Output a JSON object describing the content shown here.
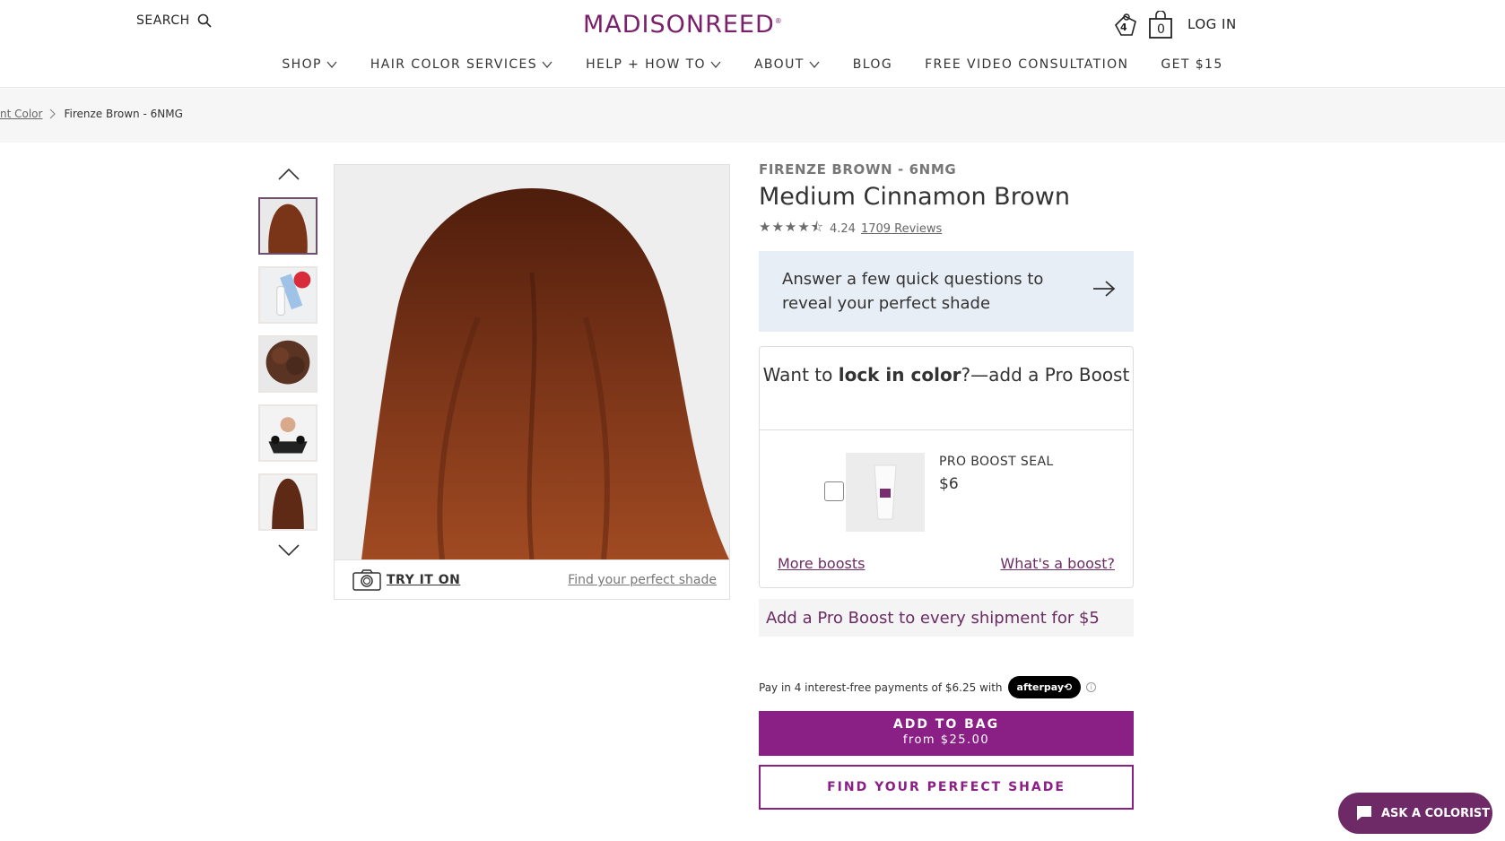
{
  "header": {
    "search_label": "SEARCH",
    "logo": "MADISONREED",
    "logo_reg": "®",
    "rewards_count": "4",
    "bag_count": "0",
    "login_label": "LOG IN"
  },
  "nav": {
    "items": [
      {
        "label": "SHOP",
        "dropdown": true
      },
      {
        "label": "HAIR COLOR SERVICES",
        "dropdown": true
      },
      {
        "label": "HELP + HOW TO",
        "dropdown": true
      },
      {
        "label": "ABOUT",
        "dropdown": true
      },
      {
        "label": "BLOG",
        "dropdown": false
      },
      {
        "label": "FREE VIDEO CONSULTATION",
        "dropdown": false
      },
      {
        "label": "GET $15",
        "dropdown": false
      }
    ]
  },
  "breadcrumb": {
    "parent": "nt Color",
    "current": "Firenze Brown - 6NMG"
  },
  "gallery": {
    "try_on": "TRY IT ON",
    "find_shade": "Find your perfect shade"
  },
  "product": {
    "shade_code": "FIRENZE BROWN - 6NMG",
    "name": "Medium Cinnamon Brown",
    "stars": "★★★★⯪",
    "rating": "4.24",
    "reviews": "1709 Reviews"
  },
  "quiz": {
    "text": "Answer a few quick questions to reveal your perfect shade"
  },
  "boost": {
    "head_pre": "Want to ",
    "head_bold": "lock in color",
    "head_post": "?—add a Pro Boost",
    "name": "PRO BOOST SEAL",
    "price": "$6",
    "more": "More boosts",
    "whats": "What's a boost?"
  },
  "every_shipment": "Add a Pro Boost to every shipment for $5",
  "afterpay": {
    "text": "Pay in 4 interest-free payments of $6.25 with",
    "logo": "afterpay⟲",
    "info": "i"
  },
  "cta": {
    "add_to_bag": "ADD TO BAG",
    "from_price": "from $25.00",
    "find_shade": "FIND YOUR PERFECT SHADE"
  },
  "chat": {
    "label": "ASK A COLORIST"
  },
  "colors": {
    "brand": "#8a1f86",
    "logo": "#7a1f6b",
    "hair": "#7a3418"
  }
}
